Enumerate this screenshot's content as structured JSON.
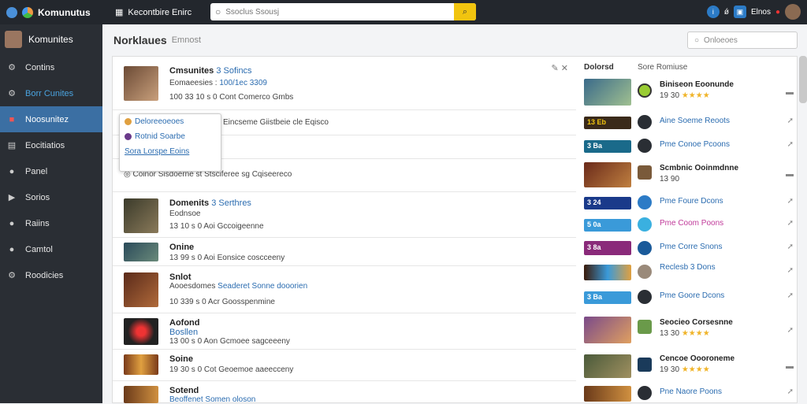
{
  "topbar": {
    "app_title": "Komunutus",
    "nav_label": "Kecontbire Enirc",
    "search_placeholder": "Ssoclus Ssousj",
    "right_label": "Elnos"
  },
  "sidebar": {
    "user_name": "Komunites",
    "items": [
      {
        "label": "Contins",
        "icon": "gear-icon"
      },
      {
        "label": "Borr Cunites",
        "icon": "gear-icon"
      },
      {
        "label": "Noosunitez",
        "icon": "alert-icon",
        "active": true
      },
      {
        "label": "Eocitiatios",
        "icon": "document-icon"
      },
      {
        "label": "Panel",
        "icon": "chat-icon"
      },
      {
        "label": "Sorios",
        "icon": "play-icon"
      },
      {
        "label": "Raiins",
        "icon": "chat-icon"
      },
      {
        "label": "Camtol",
        "icon": "chat-icon"
      },
      {
        "label": "Roodicies",
        "icon": "gear-icon"
      }
    ]
  },
  "main": {
    "title": "Norklaues",
    "subtitle": "Emnost",
    "search_placeholder": "Onloeoes",
    "right_headers": [
      "Dolorsd",
      "Sore Romiuse"
    ]
  },
  "posts": [
    {
      "title": "Cmsunites",
      "tag": "3 Sofincs",
      "line2": "Eomaeesies :",
      "line2_hl": "100/1ec 3309",
      "meta": "100 33 10 s 0 Cont Comerco Gmbs"
    },
    {
      "line": "Eincseme Giistbeie cle Eqisco",
      "popup": [
        "Deloreeoeoes",
        "Rotnid Soarbe",
        "Sora Lorspe Eoins"
      ]
    },
    {
      "line": "Coinor Sisdoerne st Stsciferee sg Cqiseereco"
    },
    {
      "title": "Domenits",
      "tag": "3 Serthres",
      "line2": "Eodnsoe",
      "meta": "13 10 s 0 Aoi Gccoigeenne"
    },
    {
      "title": "Onine",
      "meta": "13 99 s 0 Aoi Eonsice coscceeny"
    },
    {
      "title": "Snlot",
      "line2": "Aooesdomes",
      "line2_hl": "Seaderet Sonne dooorien",
      "meta": "10 339 s 0 Acr Goosspenmine"
    },
    {
      "title": "Aofond",
      "tag": "Bosllen",
      "meta": "13 00 s 0 Aon Gcmoee sagceeeny"
    },
    {
      "title": "Soine",
      "meta": "19 30 s 0 Cot Geoemoe aaeecceny"
    },
    {
      "title": "Sotend",
      "line2_hl": "Beoffenet Somen oloson"
    }
  ],
  "right_rows": [
    {
      "title": "Biniseon Eoonunde",
      "sub": "19 30",
      "stars": "★★★★",
      "bold": true
    },
    {
      "label": "13 Eb",
      "title": "Aine Soeme Reoots"
    },
    {
      "label": "3 Ba",
      "title": "Pme Conoe Pcoons"
    },
    {
      "title": "Scmbnic Ooinmdnne",
      "sub": "13 90",
      "stars": "",
      "bold": true
    },
    {
      "label": "3 24",
      "title": "Pme Foure Dcons"
    },
    {
      "label": "5 0a",
      "title": "Pme Coom Poons"
    },
    {
      "label": "3 8a",
      "title": "Pme Corre Snons"
    },
    {
      "title": "Reclesb 3 Dons",
      "sub": "",
      "stars": "",
      "bold": false
    },
    {
      "label": "3 Ba",
      "title": "Pme Goore Dcons"
    },
    {
      "title": "Seocieo Corsesnne",
      "sub": "13 30",
      "stars": "★★★★",
      "bold": true
    },
    {
      "title": "Cencoe Oooroneme",
      "sub": "19 30",
      "stars": "★★★★",
      "bold": true
    },
    {
      "title": "Pne Naore Poons"
    }
  ],
  "colors": {
    "accent": "#2b6cb0",
    "active": "#3b6fa3",
    "search_btn": "#f1c40f"
  }
}
